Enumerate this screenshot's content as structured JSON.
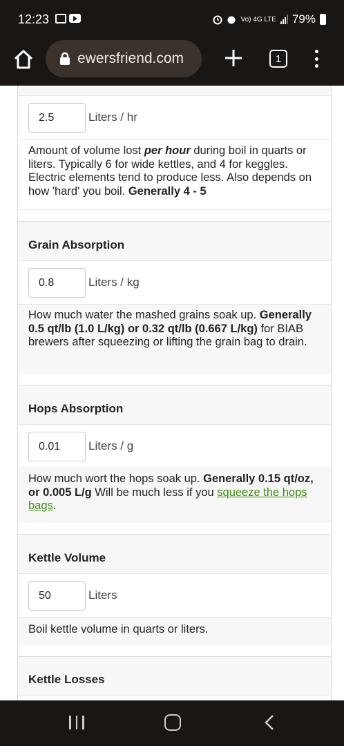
{
  "status_bar": {
    "time": "12:23",
    "network": "Vo) 4G LTE",
    "battery": "79%"
  },
  "browser": {
    "url": "ewersfriend.com",
    "tab_count": "1",
    "icons": [
      "home-icon",
      "lock-icon",
      "plus-icon",
      "tabs-icon",
      "menu-icon"
    ]
  },
  "sections": {
    "boiloff": {
      "value": "2.5",
      "unit": "Liters / hr",
      "desc_pre": "Amount of volume lost ",
      "desc_em": "per hour",
      "desc_mid": " during boil in quarts or liters. Typically 6 for wide kettles, and 4 for keggles. Electric elements tend to produce less. Also depends on how 'hard' you boil. ",
      "desc_strong": "Generally 4 - 5"
    },
    "grain": {
      "title": "Grain Absorption",
      "value": "0.8",
      "unit": "Liters / kg",
      "desc_pre": "How much water the mashed grains soak up. ",
      "desc_strong": "Generally 0.5 qt/lb (1.0 L/kg) or 0.32 qt/lb (0.667 L/kg)",
      "desc_post": " for BIAB brewers after squeezing or lifting the grain bag to drain."
    },
    "hops": {
      "title": "Hops Absorption",
      "value": "0.01",
      "unit": "Liters / g",
      "desc_pre": "How much wort the hops soak up. ",
      "desc_strong": "Generally 0.15 qt/oz, or 0.005 L/g",
      "desc_mid": " Will be much less if you ",
      "desc_link": "squeeze the hops bags",
      "desc_post": "."
    },
    "kettle": {
      "title": "Kettle Volume",
      "value": "50",
      "unit": "Liters",
      "desc": "Boil kettle volume in quarts or liters."
    },
    "losses": {
      "title": "Kettle Losses"
    }
  },
  "colors": {
    "chrome": "#1a1613",
    "url_pill": "#3a322b",
    "link": "#3c8a12"
  }
}
